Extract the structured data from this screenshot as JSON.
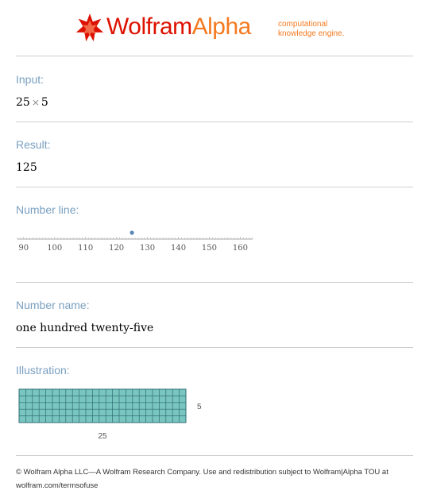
{
  "header": {
    "logo_wolfram": "Wolfram",
    "logo_alpha": "Alpha",
    "tagline_line1": "computational",
    "tagline_line2": "knowledge engine.",
    "brand_red": "#dd1100",
    "brand_orange": "#f47920"
  },
  "pods": {
    "input": {
      "title": "Input:",
      "left": "25",
      "operator": "×",
      "right": "5"
    },
    "result": {
      "title": "Result:",
      "value": "125"
    },
    "number_line": {
      "title": "Number line:",
      "ticks": [
        "90",
        "100",
        "110",
        "120",
        "130",
        "140",
        "150",
        "160"
      ],
      "range": [
        88,
        164
      ],
      "marker_value": 125
    },
    "number_name": {
      "title": "Number name:",
      "value": "one hundred twenty-five"
    },
    "illustration": {
      "title": "Illustration:",
      "columns": 25,
      "rows": 5,
      "width_label": "25",
      "height_label": "5",
      "fill_color": "#79c5c0",
      "line_color": "#2f6e73"
    }
  },
  "footer": {
    "line1": "© Wolfram Alpha LLC—A Wolfram Research Company. Use and redistribution subject to Wolfram|Alpha TOU at",
    "line2": "wolfram.com/termsofuse"
  },
  "colors": {
    "pod_title": "#7aa0c0",
    "marker": "#5a87b5"
  }
}
